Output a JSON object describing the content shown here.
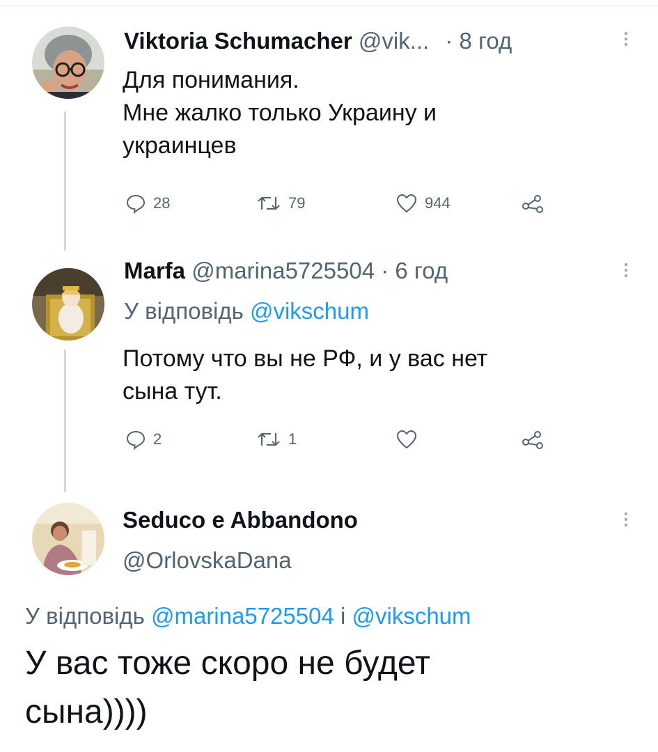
{
  "tweet1": {
    "name": "Viktoria Schumacher",
    "handle": "@vik...",
    "time": "· 8 год",
    "lines": [
      "Для понимания.",
      "Мне жалко только Украину и",
      "украинцев"
    ],
    "replies": "28",
    "retweets": "79",
    "likes": "944",
    "icons": [
      "reply-icon",
      "retweet-icon",
      "like-icon",
      "share-icon",
      "more-icon"
    ]
  },
  "tweet2": {
    "name": "Marfa",
    "handle": "@marina5725504",
    "time": "· 6 год",
    "reply_prefix": "У відповідь",
    "reply_to": "@vikschum",
    "lines": [
      "Потому что вы не РФ, и у вас нет",
      "сына тут."
    ],
    "replies": "2",
    "retweets": "1",
    "likes": ""
  },
  "tweet3": {
    "name": "Seduco e Abbandono",
    "handle": "@OrlovskaDana",
    "reply_prefix": "У відповідь",
    "reply_to_1": "@marina5725504",
    "reply_joiner": "i",
    "reply_to_2": "@vikschum",
    "lines": [
      "У вас тоже скоро не будет",
      "сына))))"
    ]
  },
  "colors": {
    "link": "#1d9bf0",
    "muted": "#536471",
    "thread_line": "#cfd9de",
    "text": "#0f1419"
  }
}
